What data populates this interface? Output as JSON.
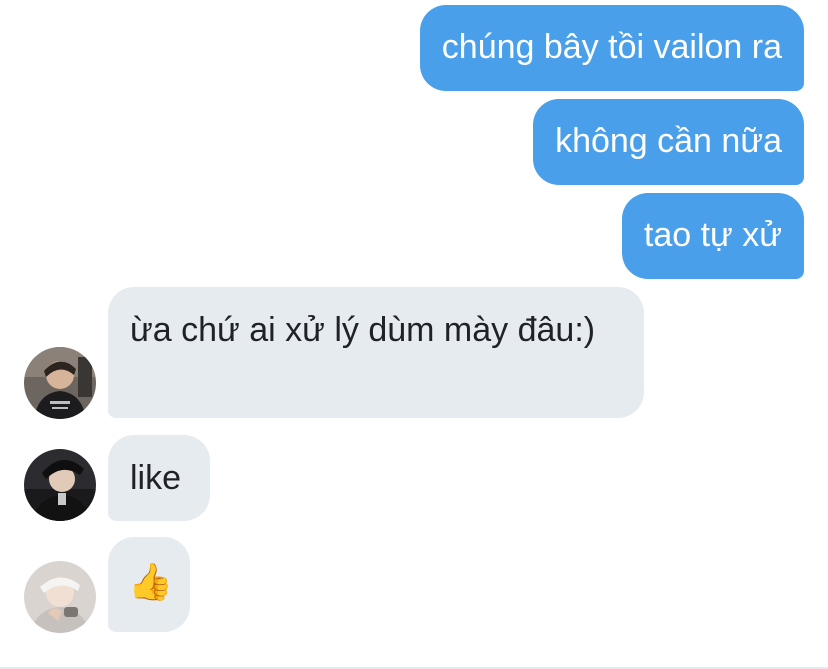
{
  "messages": {
    "sent": [
      {
        "text": "chúng bây tồi vailon ra"
      },
      {
        "text": "không cần nữa"
      },
      {
        "text": "tao tự xử"
      }
    ],
    "received": [
      {
        "text": "ừa chứ ai xử lý dùm mày đâu:)",
        "avatar": "user-avatar-1"
      },
      {
        "text": "like",
        "avatar": "user-avatar-2"
      },
      {
        "text": "👍",
        "avatar": "user-avatar-3",
        "icon": "thumbs-up-emoji"
      }
    ]
  },
  "colors": {
    "sent_bubble": "#4a9fea",
    "received_bubble": "#e6ebf0",
    "sent_text": "#ffffff",
    "received_text": "#1f2226"
  }
}
